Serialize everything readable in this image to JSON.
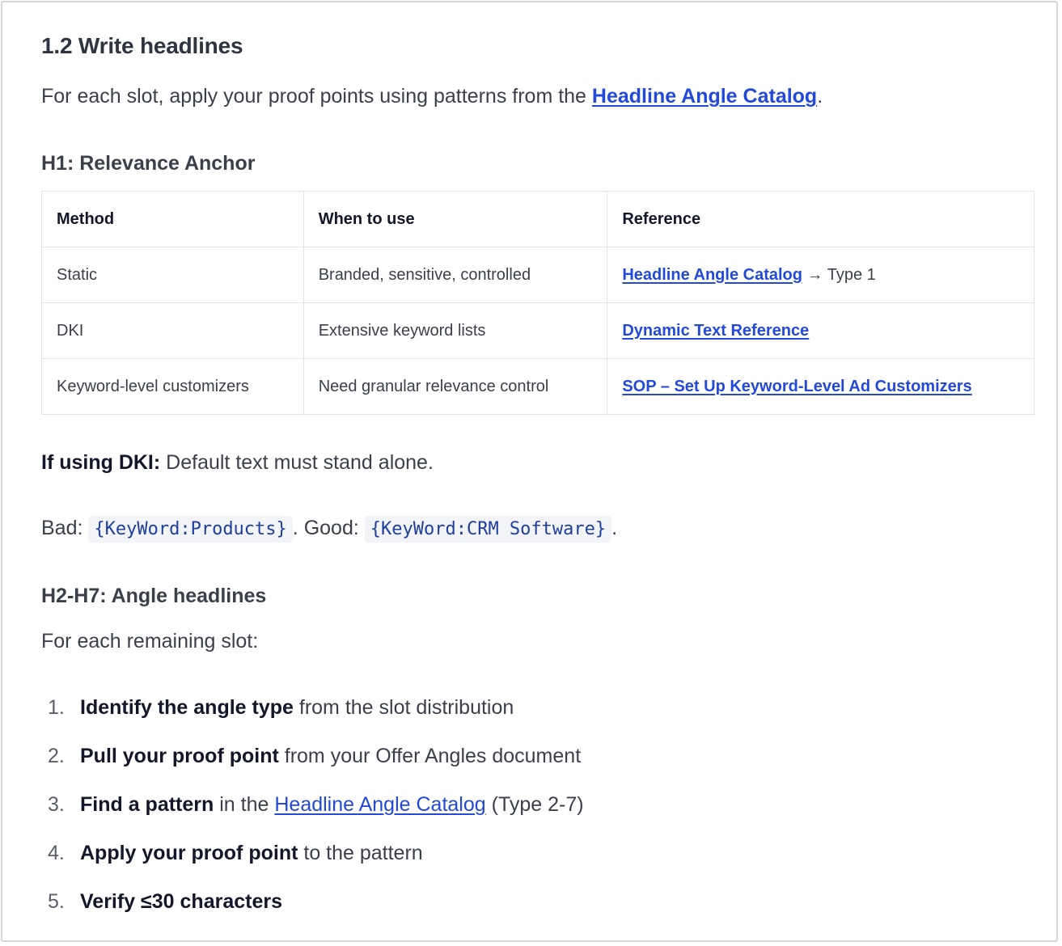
{
  "section": {
    "title": "1.2 Write headlines"
  },
  "intro": {
    "before": "For each slot, apply your proof points using patterns from the ",
    "link": "Headline Angle Catalog",
    "after": "."
  },
  "h1_section": {
    "title": "H1: Relevance Anchor"
  },
  "table": {
    "headers": [
      "Method",
      "When to use",
      "Reference"
    ],
    "rows": [
      {
        "method": "Static",
        "when": "Branded, sensitive, controlled",
        "ref_link": "Headline Angle Catalog",
        "ref_suffix": " → Type 1"
      },
      {
        "method": "DKI",
        "when": "Extensive keyword lists",
        "ref_link": "Dynamic Text Reference",
        "ref_suffix": ""
      },
      {
        "method": "Keyword-level customizers",
        "when": "Need granular relevance control",
        "ref_link": "SOP – Set Up Keyword-Level Ad Customizers",
        "ref_suffix": ""
      }
    ]
  },
  "dki_note": {
    "label": "If using DKI:",
    "text": " Default text must stand alone."
  },
  "example": {
    "bad_label": "Bad: ",
    "bad_code": "{KeyWord:Products}",
    "sep": ". Good: ",
    "good_code": "{KeyWord:CRM Software}",
    "end": "."
  },
  "h2_section": {
    "title": "H2-H7: Angle headlines",
    "intro": "For each remaining slot:"
  },
  "steps": [
    {
      "num": "1.",
      "bold": "Identify the angle type",
      "rest": " from the slot distribution"
    },
    {
      "num": "2.",
      "bold": "Pull your proof point",
      "rest": " from your Offer Angles document"
    },
    {
      "num": "3.",
      "bold": "Find a pattern",
      "middle": " in the ",
      "link": "Headline Angle Catalog",
      "rest": " (Type 2-7)"
    },
    {
      "num": "4.",
      "bold": "Apply your proof point",
      "rest": " to the pattern"
    },
    {
      "num": "5.",
      "bold": "Verify ≤30 characters",
      "rest": ""
    }
  ],
  "colors": {
    "link": "#2349d8",
    "text": "#3b3f4a",
    "heading": "#2f3441",
    "code": "#1e3f9e",
    "border": "#e1e3e7"
  }
}
